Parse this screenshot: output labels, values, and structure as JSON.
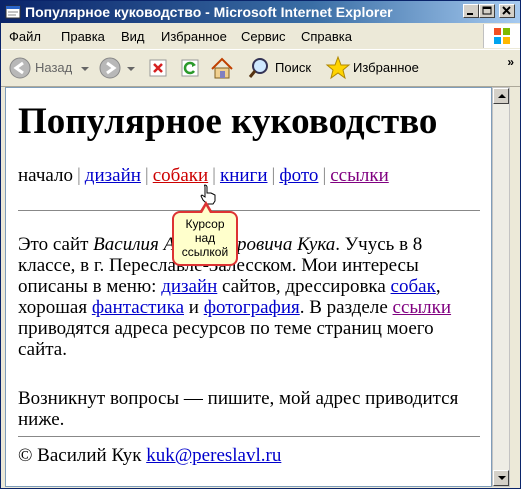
{
  "window": {
    "title": "Популярное куководство - Microsoft Internet Explorer"
  },
  "menu": [
    "Файл",
    "Правка",
    "Вид",
    "Избранное",
    "Сервис",
    "Справка"
  ],
  "toolbar": {
    "back_label": "Назад",
    "search_label": "Поиск",
    "favorites_label": "Избранное",
    "more": "»"
  },
  "page": {
    "heading": "Популярное куководство",
    "nav": {
      "current": "начало",
      "links": [
        "дизайн",
        "собаки",
        "книги",
        "фото",
        "ссылки"
      ],
      "separator": "|"
    },
    "para1": {
      "t1": "Это сайт ",
      "name": "Василия Александровича Кука",
      "t2": ". Учусь в 8 классе, в г. Переславле-Залесском. Мои интересы описаны в меню: ",
      "l1": "дизайн",
      "t3": " сайтов, дрессировка ",
      "l2": "собак",
      "t4": ", хорошая ",
      "l3": "фантастика",
      "t5": " и ",
      "l4": "фотография",
      "t6": ". В разделе ",
      "l5": "ссылки",
      "t7": " приводятся адреса ресурсов по теме страниц моего сайта."
    },
    "para2": "Возникнут вопросы — пишите, мой адрес приводится ниже.",
    "footer": {
      "copyright": "© Василий Кук",
      "email": "kuk@pereslavl.ru"
    }
  },
  "callout": {
    "line1": "Курсор",
    "line2": "над",
    "line3": "ссылкой"
  }
}
